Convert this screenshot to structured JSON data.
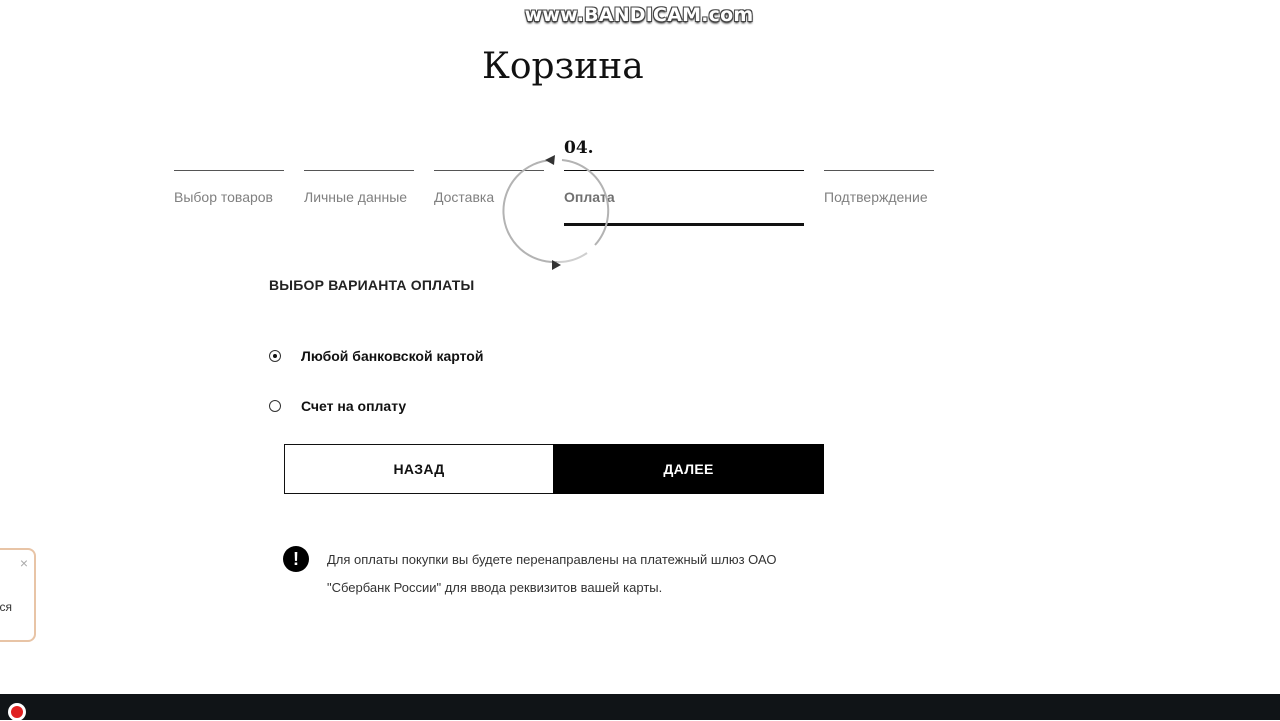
{
  "watermark": "www.BANDICAM.com",
  "page_title": "Корзина",
  "steps": [
    {
      "label": "Выбор товаров",
      "active": false
    },
    {
      "label": "Личные данные",
      "active": false
    },
    {
      "label": "Доставка",
      "active": false
    },
    {
      "number": "04.",
      "label": "Оплата",
      "active": true
    },
    {
      "label": "Подтверждение",
      "active": false
    }
  ],
  "payment": {
    "heading": "ВЫБОР ВАРИАНТА ОПЛАТЫ",
    "options": [
      {
        "label": "Любой банковской картой",
        "selected": true
      },
      {
        "label": "Счет на оплату",
        "selected": false
      }
    ]
  },
  "buttons": {
    "back": "НАЗАД",
    "next": "ДАЛЕЕ"
  },
  "notice": {
    "icon": "!",
    "text": "Для оплаты покупки вы будете перенаправлены на платежный шлюз ОАО \"Сбербанк России\" для ввода реквизитов вашей карты."
  },
  "popup": {
    "close": "×",
    "text": "ся"
  },
  "colors": {
    "accent": "#000000",
    "popup_border": "#e8c4a6",
    "record": "#e02020",
    "taskbar": "#101417"
  }
}
